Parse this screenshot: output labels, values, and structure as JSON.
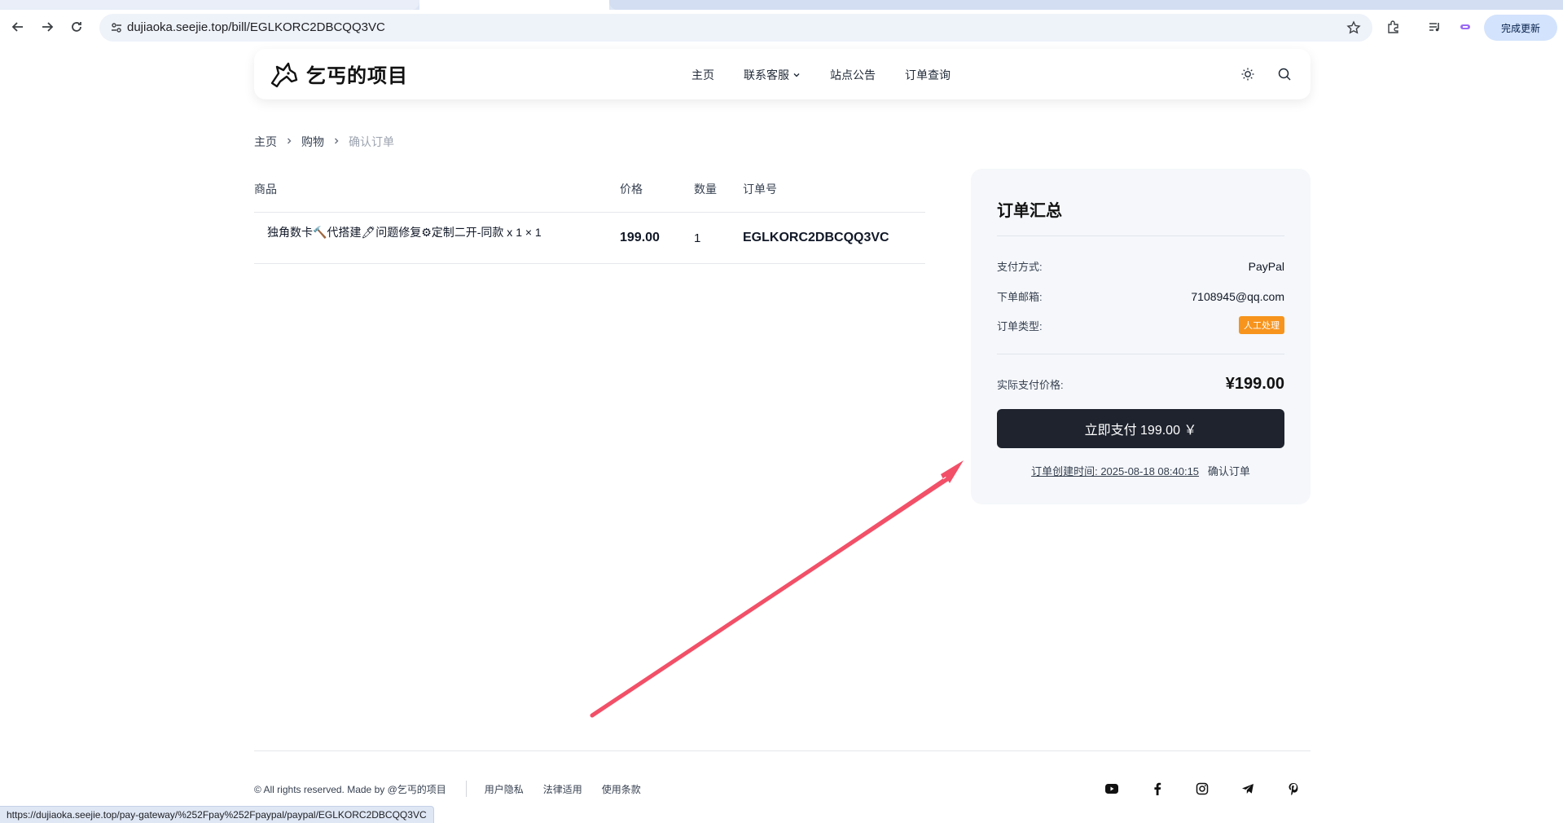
{
  "browser": {
    "url": "dujiaoka.seejie.top/bill/EGLKORC2DBCQQ3VC",
    "update_label": "完成更新",
    "status_url": "https://dujiaoka.seejie.top/pay-gateway/%252Fpay%252Fpaypal/paypal/EGLKORC2DBCQQ3VC"
  },
  "header": {
    "logo_text": "乞丐的项目",
    "nav": [
      {
        "label": "主页"
      },
      {
        "label": "联系客服"
      },
      {
        "label": "站点公告"
      },
      {
        "label": "订单查询"
      }
    ]
  },
  "breadcrumb": {
    "items": [
      "主页",
      "购物",
      "确认订单"
    ]
  },
  "table": {
    "headers": [
      "商品",
      "价格",
      "数量",
      "订单号"
    ],
    "rows": [
      {
        "product": "独角数卡🔨代搭建🖊问题修复⚙定制二开-同款 x 1 × 1",
        "price": "199.00",
        "qty": "1",
        "order_no": "EGLKORC2DBCQQ3VC"
      }
    ]
  },
  "summary": {
    "title": "订单汇总",
    "pay_method_label": "支付方式:",
    "pay_method_value": "PayPal",
    "email_label": "下单邮箱:",
    "email_value": "7108945@qq.com",
    "type_label": "订单类型:",
    "type_value": "人工处理",
    "total_label": "实际支付价格:",
    "total_value": "¥199.00",
    "pay_button": "立即支付 199.00 ￥",
    "created_text": "订单创建时间: 2025-08-18 08:40:15",
    "confirm_text": "确认订单"
  },
  "footer": {
    "copyright": "© All rights reserved. Made by @乞丐的项目",
    "links": [
      "用户隐私",
      "法律适用",
      "使用条款"
    ]
  },
  "colors": {
    "badge": "#f7941d",
    "pay_button": "#1e232e",
    "annotation_arrow": "#f25068"
  }
}
